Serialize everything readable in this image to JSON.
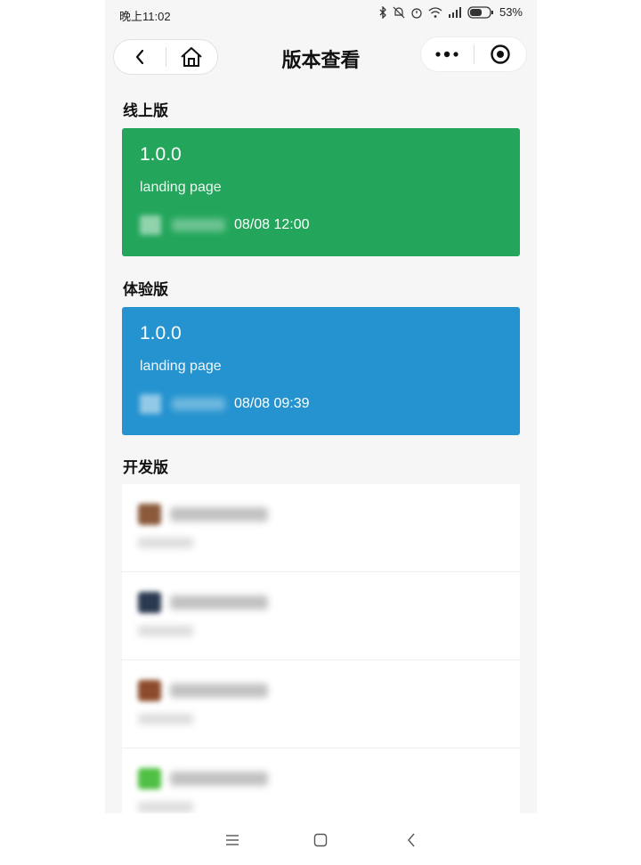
{
  "statusbar": {
    "time": "晚上11:02",
    "battery_pct": "53%"
  },
  "navbar": {
    "title": "版本查看"
  },
  "sections": {
    "online": "线上版",
    "trial": "体验版",
    "dev": "开发版"
  },
  "online_card": {
    "version": "1.0.0",
    "description": "landing page",
    "date": "08/08 12:00",
    "color": "#23a65b"
  },
  "trial_card": {
    "version": "1.0.0",
    "description": "landing page",
    "date": "08/08 09:39",
    "color": "#2593cf"
  },
  "dev_items": [
    {
      "avatar_color": "#8a5a3b"
    },
    {
      "avatar_color": "#2b3950"
    },
    {
      "avatar_color": "#8c4b2a"
    },
    {
      "avatar_color": "#4fc043"
    }
  ],
  "icons": {
    "back": "chevron-left-icon",
    "home": "home-icon",
    "more": "more-dots-icon",
    "close": "target-circle-icon",
    "menu": "menu-lines-icon",
    "square": "square-icon",
    "nav_back": "triangle-back-icon"
  }
}
